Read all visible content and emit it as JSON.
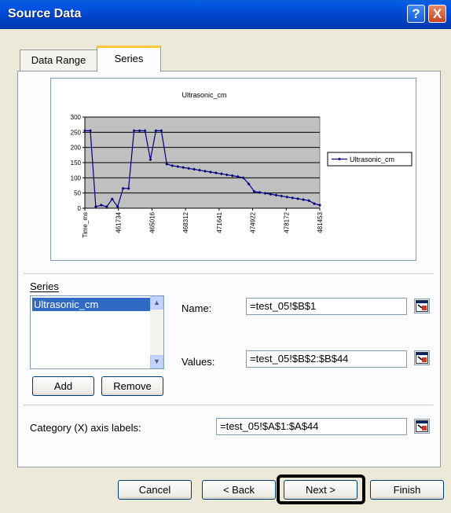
{
  "window": {
    "title": "Source Data",
    "help_glyph": "?",
    "close_glyph": "X"
  },
  "tabs": {
    "data_range": "Data Range",
    "series": "Series"
  },
  "chart_data": {
    "type": "line",
    "title": "Ultrasonic_cm",
    "x_tick_labels": [
      "Time_ms",
      "461734",
      "465016",
      "468312",
      "471641",
      "474922",
      "478172",
      "481453"
    ],
    "y_tick_labels": [
      "300",
      "250",
      "200",
      "150",
      "100",
      "50",
      "0"
    ],
    "ylim": [
      0,
      300
    ],
    "grid": "horizontal",
    "legend_position": "right",
    "series": [
      {
        "name": "Ultrasonic_cm",
        "color": "#000080",
        "values": [
          255,
          255,
          5,
          10,
          5,
          30,
          5,
          65,
          65,
          255,
          255,
          255,
          160,
          255,
          255,
          145,
          140,
          137,
          134,
          131,
          128,
          125,
          122,
          119,
          116,
          113,
          110,
          107,
          104,
          100,
          80,
          55,
          52,
          49,
          46,
          43,
          40,
          37,
          34,
          31,
          28,
          25,
          15,
          10
        ]
      }
    ]
  },
  "series_section": {
    "label": "Series",
    "items": [
      "Ultrasonic_cm"
    ]
  },
  "buttons": {
    "add": "Add",
    "remove": "Remove",
    "cancel": "Cancel",
    "back": "< Back",
    "next": "Next >",
    "finish": "Finish"
  },
  "fields": {
    "name_label": "Name:",
    "name_value": "=test_05!$B$1",
    "values_label": "Values:",
    "values_value": "=test_05!$B$2:$B$44",
    "category_label": "Category (X) axis labels:",
    "category_value": "=test_05!$A$1:$A$44"
  }
}
